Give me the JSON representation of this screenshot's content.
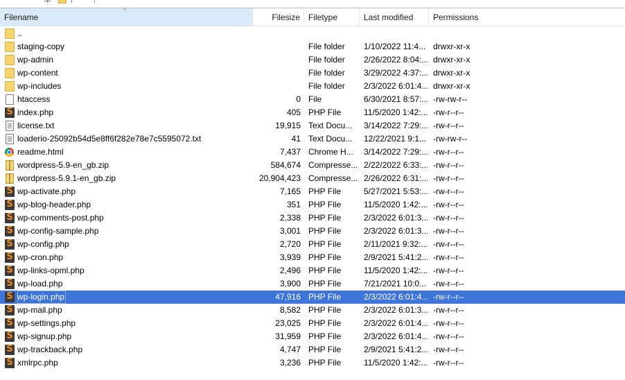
{
  "columns": {
    "filename": "Filename",
    "filesize": "Filesize",
    "filetype": "Filetype",
    "last_modified": "Last modified",
    "permissions": "Permissions"
  },
  "sorted_column": "Filename",
  "selected_file": "wp-login.php",
  "files": [
    {
      "name": "..",
      "size": "",
      "type": "",
      "modified": "",
      "perms": "",
      "icon": "folder-icon"
    },
    {
      "name": "staging-copy",
      "size": "",
      "type": "File folder",
      "modified": "1/10/2022 11:4...",
      "perms": "drwxr-xr-x",
      "icon": "folder-icon"
    },
    {
      "name": "wp-admin",
      "size": "",
      "type": "File folder",
      "modified": "2/26/2022 8:04:...",
      "perms": "drwxr-xr-x",
      "icon": "folder-icon"
    },
    {
      "name": "wp-content",
      "size": "",
      "type": "File folder",
      "modified": "3/29/2022 4:37:...",
      "perms": "drwxr-xr-x",
      "icon": "folder-icon"
    },
    {
      "name": "wp-includes",
      "size": "",
      "type": "File folder",
      "modified": "2/3/2022 6:01:4...",
      "perms": "drwxr-xr-x",
      "icon": "folder-icon"
    },
    {
      "name": "htaccess",
      "size": "0",
      "type": "File",
      "modified": "6/30/2021 8:57:...",
      "perms": "-rw-rw-r--",
      "icon": "file-icon"
    },
    {
      "name": "index.php",
      "size": "405",
      "type": "PHP File",
      "modified": "11/5/2020 1:42:...",
      "perms": "-rw-r--r--",
      "icon": "php-file-icon"
    },
    {
      "name": "license.txt",
      "size": "19,915",
      "type": "Text Docu...",
      "modified": "3/14/2022 7:29:...",
      "perms": "-rw-r--r--",
      "icon": "text-file-icon"
    },
    {
      "name": "loaderio-25092b54d5e8ff6f282e78e7c5595072.txt",
      "size": "41",
      "type": "Text Docu...",
      "modified": "12/22/2021 9:1...",
      "perms": "-rw-rw-r--",
      "icon": "text-file-icon"
    },
    {
      "name": "readme.html",
      "size": "7,437",
      "type": "Chrome H...",
      "modified": "3/14/2022 7:29:...",
      "perms": "-rw-r--r--",
      "icon": "chrome-icon"
    },
    {
      "name": "wordpress-5.9-en_gb.zip",
      "size": "584,674",
      "type": "Compresse...",
      "modified": "2/22/2022 6:33:...",
      "perms": "-rw-r--r--",
      "icon": "zip-file-icon"
    },
    {
      "name": "wordpress-5.9.1-en_gb.zip",
      "size": "20,904,423",
      "type": "Compresse...",
      "modified": "2/26/2022 6:31:...",
      "perms": "-rw-r--r--",
      "icon": "zip-file-icon"
    },
    {
      "name": "wp-activate.php",
      "size": "7,165",
      "type": "PHP File",
      "modified": "5/27/2021 5:53:...",
      "perms": "-rw-r--r--",
      "icon": "php-file-icon"
    },
    {
      "name": "wp-blog-header.php",
      "size": "351",
      "type": "PHP File",
      "modified": "11/5/2020 1:42:...",
      "perms": "-rw-r--r--",
      "icon": "php-file-icon"
    },
    {
      "name": "wp-comments-post.php",
      "size": "2,338",
      "type": "PHP File",
      "modified": "2/3/2022 6:01:3...",
      "perms": "-rw-r--r--",
      "icon": "php-file-icon"
    },
    {
      "name": "wp-config-sample.php",
      "size": "3,001",
      "type": "PHP File",
      "modified": "2/3/2022 6:01:3...",
      "perms": "-rw-r--r--",
      "icon": "php-file-icon"
    },
    {
      "name": "wp-config.php",
      "size": "2,720",
      "type": "PHP File",
      "modified": "2/11/2021 9:32:...",
      "perms": "-rw-r--r--",
      "icon": "php-file-icon"
    },
    {
      "name": "wp-cron.php",
      "size": "3,939",
      "type": "PHP File",
      "modified": "2/9/2021 5:41:2...",
      "perms": "-rw-r--r--",
      "icon": "php-file-icon"
    },
    {
      "name": "wp-links-opml.php",
      "size": "2,496",
      "type": "PHP File",
      "modified": "11/5/2020 1:42:...",
      "perms": "-rw-r--r--",
      "icon": "php-file-icon"
    },
    {
      "name": "wp-load.php",
      "size": "3,900",
      "type": "PHP File",
      "modified": "7/21/2021 10:0...",
      "perms": "-rw-r--r--",
      "icon": "php-file-icon"
    },
    {
      "name": "wp-login.php",
      "size": "47,916",
      "type": "PHP File",
      "modified": "2/3/2022 6:01:4...",
      "perms": "-rw-r--r--",
      "icon": "php-file-icon"
    },
    {
      "name": "wp-mail.php",
      "size": "8,582",
      "type": "PHP File",
      "modified": "2/3/2022 6:01:3...",
      "perms": "-rw-r--r--",
      "icon": "php-file-icon"
    },
    {
      "name": "wp-settings.php",
      "size": "23,025",
      "type": "PHP File",
      "modified": "2/3/2022 6:01:4...",
      "perms": "-rw-r--r--",
      "icon": "php-file-icon"
    },
    {
      "name": "wp-signup.php",
      "size": "31,959",
      "type": "PHP File",
      "modified": "2/3/2022 6:01:4...",
      "perms": "-rw-r--r--",
      "icon": "php-file-icon"
    },
    {
      "name": "wp-trackback.php",
      "size": "4,747",
      "type": "PHP File",
      "modified": "2/9/2021 5:41:2...",
      "perms": "-rw-r--r--",
      "icon": "php-file-icon"
    },
    {
      "name": "xmlrpc.php",
      "size": "3,236",
      "type": "PHP File",
      "modified": "11/5/2020 1:42:...",
      "perms": "-rw-r--r--",
      "icon": "php-file-icon"
    }
  ],
  "colors": {
    "selection": "#3d74d9",
    "sorted_header": "#d9ebf9",
    "folder": "#f7d56e"
  }
}
